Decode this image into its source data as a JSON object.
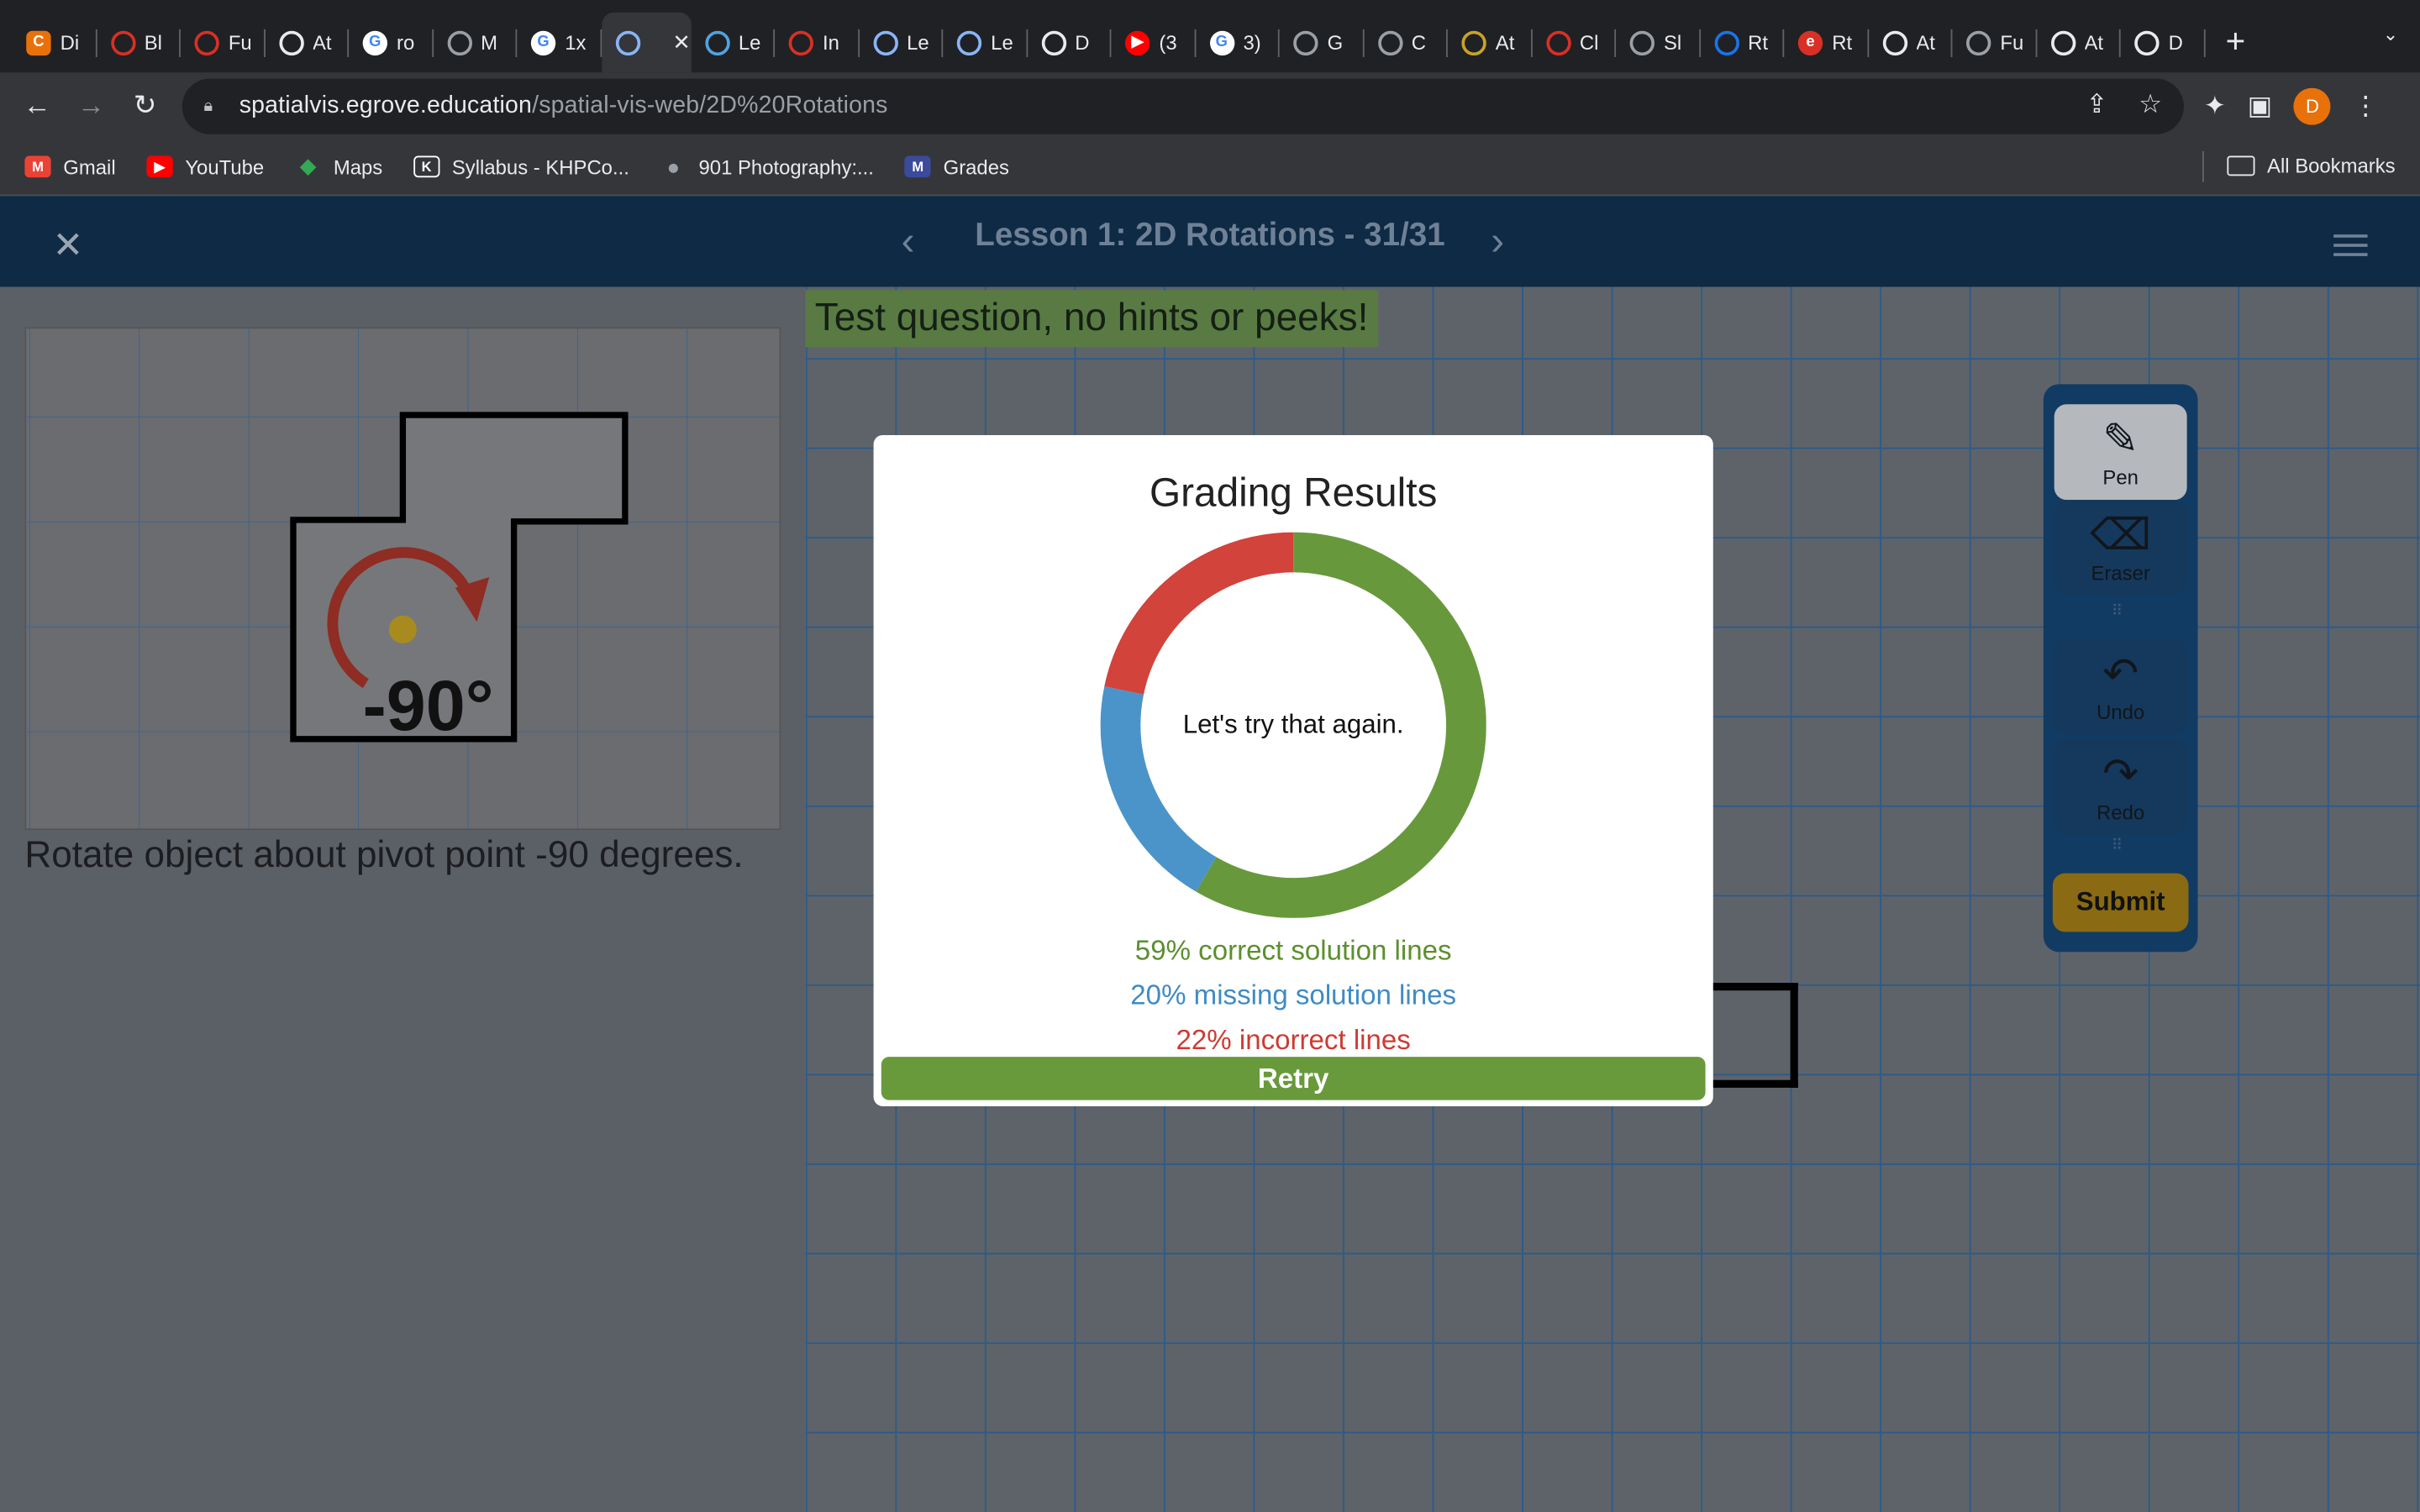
{
  "browser": {
    "tabs": [
      {
        "label": "Di",
        "icon": "canva-icon",
        "color": "#e8710a",
        "glyph": "C"
      },
      {
        "label": "Bl",
        "icon": "gear-red-icon",
        "color": "#d93025",
        "glyph": ""
      },
      {
        "label": "Fu",
        "icon": "gear-red-icon",
        "color": "#d93025",
        "glyph": ""
      },
      {
        "label": "At",
        "icon": "arrow-icon",
        "color": "#e8eaed",
        "glyph": ""
      },
      {
        "label": "ro",
        "icon": "google-icon",
        "color": "#ffffff",
        "glyph": "G"
      },
      {
        "label": "M",
        "icon": "circle-g-icon",
        "color": "#9aa0a6",
        "glyph": ""
      },
      {
        "label": "1x",
        "icon": "google-icon",
        "color": "#ffffff",
        "glyph": "G"
      },
      {
        "label": "",
        "icon": "blocks-icon",
        "color": "#8ab4f8",
        "glyph": ""
      },
      {
        "label": "Le",
        "icon": "app-icon",
        "color": "#4fa3e0",
        "glyph": ""
      },
      {
        "label": "In",
        "icon": "gear-red-icon",
        "color": "#d93025",
        "glyph": ""
      },
      {
        "label": "Le",
        "icon": "globe-icon",
        "color": "#8ab4f8",
        "glyph": ""
      },
      {
        "label": "Le",
        "icon": "globe-icon",
        "color": "#8ab4f8",
        "glyph": ""
      },
      {
        "label": "D",
        "icon": "dial-icon",
        "color": "#e8eaed",
        "glyph": ""
      },
      {
        "label": "(3",
        "icon": "youtube-icon",
        "color": "#ff0000",
        "glyph": "▶"
      },
      {
        "label": "3)",
        "icon": "google-icon",
        "color": "#ffffff",
        "glyph": "G"
      },
      {
        "label": "G",
        "icon": "spinner-icon",
        "color": "#9aa0a6",
        "glyph": ""
      },
      {
        "label": "C",
        "icon": "spinner-icon",
        "color": "#9aa0a6",
        "glyph": ""
      },
      {
        "label": "At",
        "icon": "compass-icon",
        "color": "#c9a227",
        "glyph": ""
      },
      {
        "label": "Cl",
        "icon": "gear-red-icon",
        "color": "#d93025",
        "glyph": ""
      },
      {
        "label": "Sl",
        "icon": "circle-g-icon",
        "color": "#9aa0a6",
        "glyph": ""
      },
      {
        "label": "Rt",
        "icon": "globe-blue-icon",
        "color": "#1a73e8",
        "glyph": ""
      },
      {
        "label": "Rt",
        "icon": "e-red-icon",
        "color": "#d93025",
        "glyph": "e"
      },
      {
        "label": "At",
        "icon": "dial-icon",
        "color": "#e8eaed",
        "glyph": ""
      },
      {
        "label": "Fu",
        "icon": "spinner-icon",
        "color": "#9aa0a6",
        "glyph": ""
      },
      {
        "label": "At",
        "icon": "arrow-icon",
        "color": "#e8eaed",
        "glyph": ""
      },
      {
        "label": "D",
        "icon": "dial-icon",
        "color": "#e8eaed",
        "glyph": ""
      }
    ],
    "url_host": "spatialvis.egrove.education",
    "url_path": "/spatial-vis-web/2D%20Rotations",
    "profile_initial": "D",
    "bookmarks": [
      {
        "label": "Gmail",
        "icon": "gmail-icon",
        "color": "#ea4335",
        "glyph": "M"
      },
      {
        "label": "YouTube",
        "icon": "youtube-icon",
        "color": "#ff0000",
        "glyph": "▶"
      },
      {
        "label": "Maps",
        "icon": "maps-icon",
        "color": "#34a853",
        "glyph": "◆"
      },
      {
        "label": "Syllabus - KHPCo...",
        "icon": "k-icon",
        "color": "#ffffff",
        "glyph": "K"
      },
      {
        "label": "901 Photography:...",
        "icon": "globe-icon",
        "color": "#9aa0a6",
        "glyph": "●"
      },
      {
        "label": "Grades",
        "icon": "grades-icon",
        "color": "#3b4a9b",
        "glyph": "M"
      }
    ],
    "all_bookmarks": "All Bookmarks"
  },
  "app": {
    "lesson_title": "Lesson 1: 2D Rotations - 31/31",
    "banner": "Test question, no hints or peeks!",
    "prompt": "Rotate object about pivot point -90 degrees.",
    "rotation_label": "-90°",
    "tools": {
      "pen": "Pen",
      "eraser": "Eraser",
      "undo": "Undo",
      "redo": "Redo",
      "submit": "Submit"
    }
  },
  "modal": {
    "title": "Grading Results",
    "center_text": "Let's try that again.",
    "correct_text": "59% correct solution lines",
    "missing_text": "20% missing solution lines",
    "incorrect_text": "22% incorrect lines",
    "retry_label": "Retry"
  },
  "chart_data": {
    "type": "pie",
    "donut": true,
    "categories": [
      "correct solution lines",
      "missing solution lines",
      "incorrect lines"
    ],
    "values": [
      59,
      20,
      22
    ],
    "colors": [
      "#67993c",
      "#4a94c9",
      "#d1433b"
    ]
  }
}
